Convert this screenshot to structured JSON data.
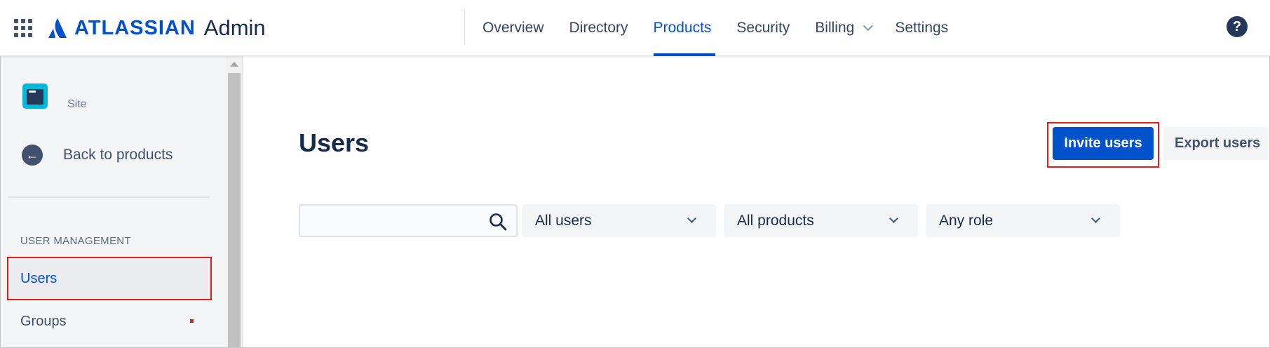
{
  "header": {
    "brand": "ATLASSIAN",
    "product": "Admin",
    "nav": [
      {
        "label": "Overview"
      },
      {
        "label": "Directory"
      },
      {
        "label": "Products"
      },
      {
        "label": "Security"
      },
      {
        "label": "Billing"
      },
      {
        "label": "Settings"
      }
    ],
    "help_glyph": "?",
    "active_nav": "Products",
    "brand_color": "#0052CC"
  },
  "sidebar": {
    "site_label": "Site",
    "back_label": "Back to products",
    "back_glyph": "←",
    "section_heading": "USER MANAGEMENT",
    "items": [
      {
        "label": "Users"
      },
      {
        "label": "Groups"
      }
    ],
    "active_item": "Users"
  },
  "main": {
    "title": "Users",
    "invite_button": "Invite users",
    "export_button": "Export users",
    "search": {
      "value": "",
      "placeholder": ""
    },
    "filters": [
      {
        "label": "All users"
      },
      {
        "label": "All products"
      },
      {
        "label": "Any role"
      }
    ]
  },
  "highlight_color": "#E01E1E"
}
